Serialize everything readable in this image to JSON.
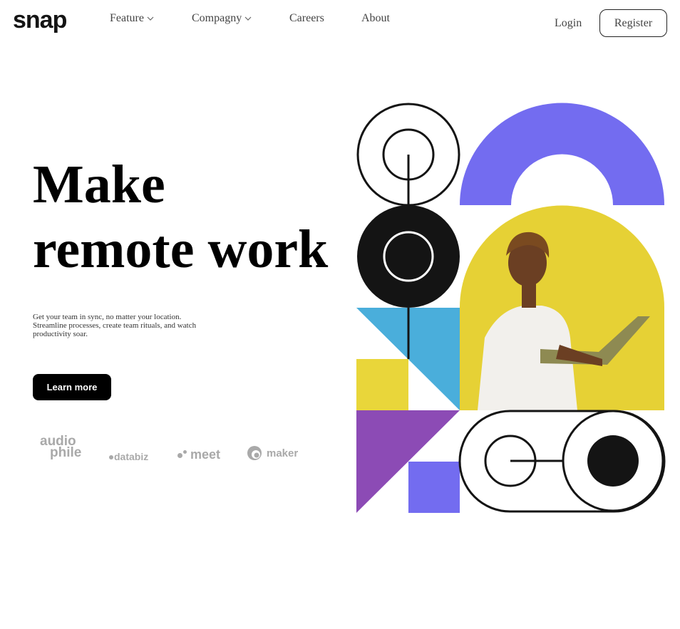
{
  "brand": {
    "logo": "snap"
  },
  "nav": {
    "items": [
      {
        "label": "Feature",
        "has_dropdown": true
      },
      {
        "label": "Compagny",
        "has_dropdown": true
      },
      {
        "label": "Careers",
        "has_dropdown": false
      },
      {
        "label": "About",
        "has_dropdown": false
      }
    ],
    "login_label": "Login",
    "register_label": "Register"
  },
  "hero": {
    "title_line1": "Make",
    "title_line2": "remote work",
    "description": "Get your team in sync, no matter your location. Streamline processes, create team rituals, and watch productivity soar.",
    "cta_label": "Learn more"
  },
  "clients": {
    "audiophile_line1": "audio",
    "audiophile_line2": "phile",
    "databiz": "databiz",
    "meet": "meet",
    "maker": "maker"
  },
  "icons": {
    "dropdown": "chevron-down-icon",
    "art": "hero-illustration"
  },
  "colors": {
    "purple": "#736CF0",
    "yellow": "#E9D63A",
    "blue": "#4AAEDB",
    "violet": "#8C4BB5",
    "dark": "#141414",
    "muted_logo": "#a9a9a9"
  }
}
